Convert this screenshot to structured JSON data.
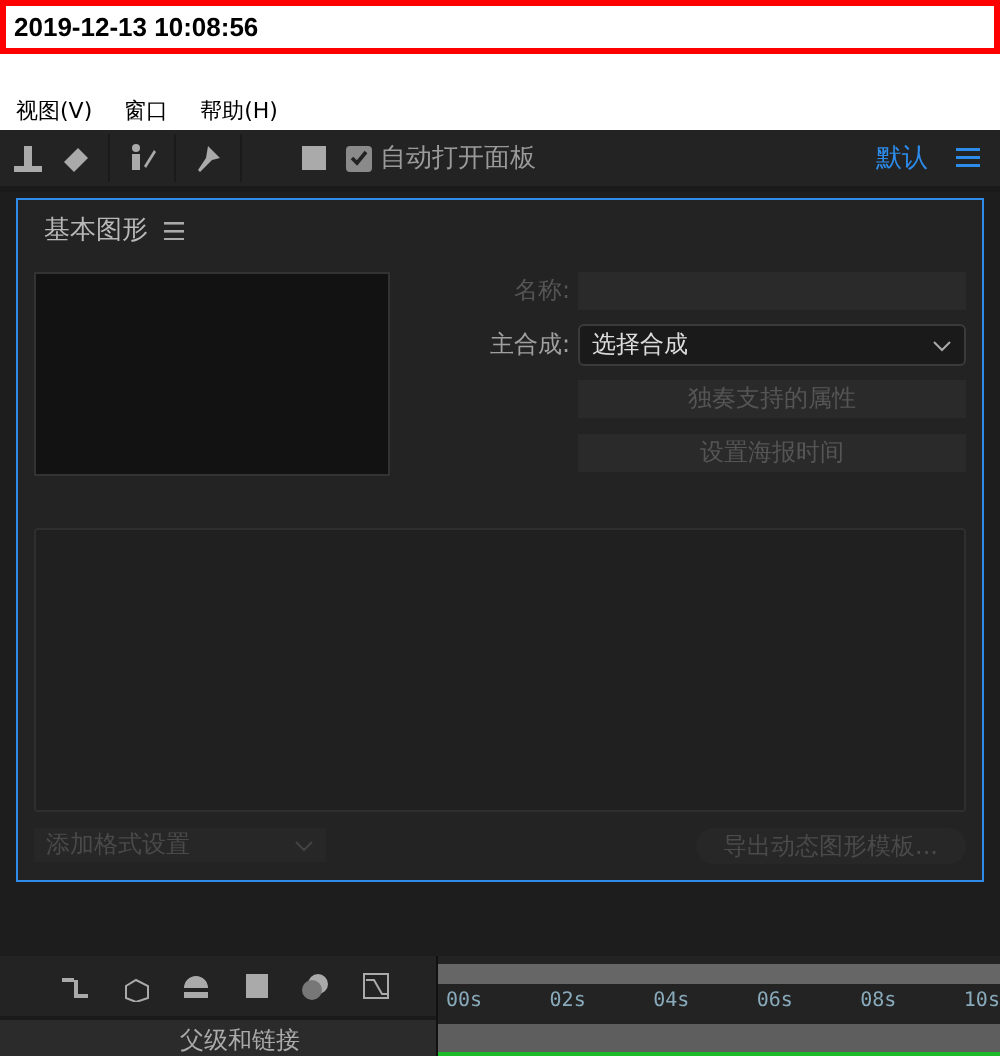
{
  "timestamp": "2019-12-13 10:08:56",
  "menu": [
    "视图(V)",
    "窗口",
    "帮助(H)"
  ],
  "toolbar": {
    "auto_open": {
      "label": "自动打开面板",
      "checked": true
    },
    "workspace": {
      "label": "默认",
      "selected": true
    }
  },
  "panel": {
    "title": "基本图形",
    "name_label": "名称:",
    "master_label": "主合成:",
    "master_value": "选择合成",
    "solo_button": {
      "label": "独奏支持的属性",
      "disabled": true
    },
    "poster_button": {
      "label": "设置海报时间",
      "disabled": true
    },
    "format_dropdown": {
      "label": "添加格式设置",
      "disabled": true
    },
    "export_button": {
      "label": "导出动态图形模板...",
      "disabled": true
    }
  },
  "timeline": {
    "column_label": "父级和链接",
    "ticks": [
      "00s",
      "02s",
      "04s",
      "06s",
      "08s",
      "10s"
    ]
  }
}
